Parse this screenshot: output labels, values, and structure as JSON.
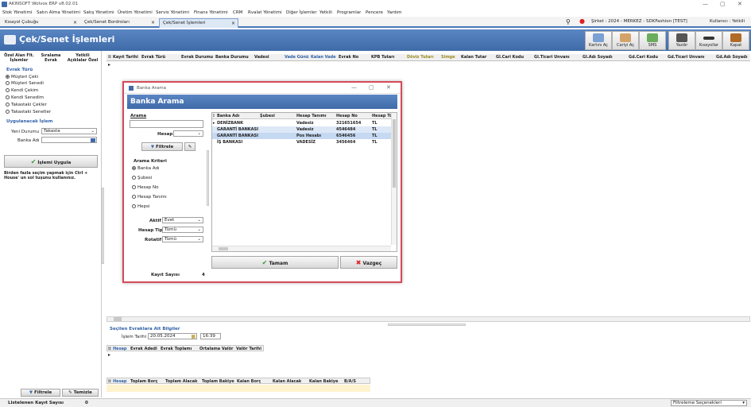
{
  "window": {
    "title": "AKINSOFT Wolvox ERP v8.02.01",
    "controls": [
      "—",
      "▢",
      "✕"
    ]
  },
  "menu": [
    "Stok Yönetimi",
    "Satın Alma Yönetimi",
    "Satış Yönetimi",
    "Üretim Yönetimi",
    "Servis Yönetimi",
    "Finans Yönetimi",
    "CRM",
    "Rvalat Yönetimi",
    "Diğer İşlemler",
    "Yetkili",
    "Programlar",
    "Pencere",
    "Yardım"
  ],
  "tabs": [
    {
      "label": "Kısayol Çubuğu",
      "active": false
    },
    {
      "label": "Çek/Senet Bordroları",
      "active": false
    },
    {
      "label": "Çek/Senet İşlemleri",
      "active": true
    }
  ],
  "header_info": {
    "company": "Şirket : 2024 - MERKEZ - SDKFashion [TEST]",
    "user": "Kullanıcı : Yetkili"
  },
  "page_title": "Çek/Senet İşlemleri",
  "toolbar": [
    {
      "label": "Kartını Aç",
      "icon": "card-icon"
    },
    {
      "label": "Cariyi Aç",
      "icon": "people-icon"
    },
    {
      "label": "SMS",
      "icon": "sms-icon"
    },
    {
      "label": "Yazdır",
      "icon": "printer-icon"
    },
    {
      "label": "Kısayollar",
      "icon": "shortcut-icon"
    },
    {
      "label": "Kapat",
      "icon": "exit-door-icon"
    }
  ],
  "left_tabs": [
    "Özel Alan Flt. İşlemler",
    "Sıralama Evrak",
    "Yetkili Açıklalar Özel"
  ],
  "evrak_turu": {
    "title": "Evrak Türü",
    "options": [
      "Müşteri Çeki",
      "Müşteri Senedi",
      "Kendi Çekim",
      "Kendi Senedim",
      "Takastaki Çekler",
      "Takastaki Senetler"
    ],
    "selected": 0
  },
  "uygulanacak": {
    "title": "Uygulanacak İşlem",
    "yeni_durumu_label": "Yeni Durumu",
    "yeni_durumu_value": "Takasta",
    "banka_adi_label": "Banka Adı",
    "banka_adi_value": "",
    "apply_button": "İşlemi Uygula"
  },
  "hint": "Birden fazla seçim yapmak için Ctrl + House' un sol tuşunu kullanınız.",
  "left_bottom": {
    "filter": "Filtrele",
    "clear": "Temizle"
  },
  "status": {
    "label": "Listelenen Kayıt Sayısı",
    "value": "0",
    "filter_select": "Filtreleme Seçenekleri"
  },
  "grid_columns": [
    "Kayıt Tarihi",
    "Evrak Türü",
    "Evrak Durumu",
    "Banka Durumu",
    "Vadesi",
    "Vade Günü",
    "Kalan Vade",
    "Evrak No",
    "KPB Tutarı",
    "Döviz Tutarı",
    "Simge",
    "Kalan Tutar",
    "Gl.Cari Kodu",
    "Gl.Ticari Unvanı",
    "Gl.Adı Soyadı",
    "Gd.Cari Kodu",
    "Gd.Ticari Unvanı",
    "Gd.Adı Soyadı"
  ],
  "selected_docs": {
    "title": "Seçilen Evraklara Ait Bilgiler",
    "islem_tarihi_label": "İşlem Tarihi",
    "islem_tarihi_value": "20.05.2024",
    "time_value": "16:39",
    "columns1": [
      "Hesap",
      "Evrak Adedi",
      "Evrak Toplamı",
      "Ortalama Valör",
      "Valör Tarihi"
    ],
    "columns2": [
      "Hesap",
      "Toplam Borç",
      "Toplam Alacak",
      "Toplam Bakiye",
      "Kalan Borç",
      "Kalan Alacak",
      "Kalan Bakiye",
      "B/A/S"
    ]
  },
  "modal": {
    "window_title": "Banka Arama",
    "header": "Banka Arama",
    "arama_label": "Arama",
    "hesap_label": "Hesap",
    "filtrele": "Filtrele",
    "kriter_title": "Arama Kriteri",
    "kriter_options": [
      "Banka Adı",
      "Şubesi",
      "Hesap No",
      "Hesap Tanımı",
      "Hepsi"
    ],
    "kriter_selected": 0,
    "aktif_label": "Aktif",
    "aktif_value": "Evet",
    "hesap_tipi_label": "Hesap Tipi",
    "hesap_tipi_value": "Tümü",
    "rotatif_label": "Rotatif",
    "rotatif_value": "Tümü",
    "kayit_label": "Kayıt Sayısı",
    "kayit_value": "4",
    "columns": [
      "Banka Adı",
      "Şubesi",
      "Hesap Tanımı",
      "Hesap No",
      "Hesap Tü"
    ],
    "rows": [
      [
        "DENİZBANK",
        "",
        "Vadesiz",
        "321651654",
        "TL"
      ],
      [
        "GARANTİ BANKASI",
        "",
        "Vadesiz",
        "4546484",
        "TL"
      ],
      [
        "GARANTİ BANKASI",
        "",
        "Pos Hesabı",
        "6546456",
        "TL"
      ],
      [
        "İŞ BANKASI",
        "",
        "VADESİZ",
        "3456464",
        "TL"
      ]
    ],
    "ok": "Tamam",
    "cancel": "Vazgeç"
  }
}
